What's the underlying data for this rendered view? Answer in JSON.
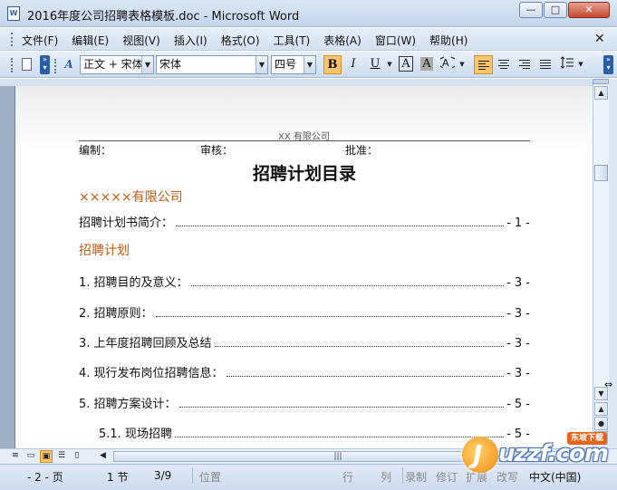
{
  "window": {
    "title": "2016年度公司招聘表格模板.doc - Microsoft Word",
    "icon": "word-doc-icon",
    "icon_text": "W",
    "min_glyph": "—",
    "max_glyph": "□",
    "close_glyph": "✕"
  },
  "menu": {
    "items": [
      "文件(F)",
      "编辑(E)",
      "视图(V)",
      "插入(I)",
      "格式(O)",
      "工具(T)",
      "表格(A)",
      "窗口(W)",
      "帮助(H)"
    ],
    "close_glyph": "✕"
  },
  "toolbar": {
    "style_value": "正文 + 宋体",
    "font_value": "宋体",
    "size_value": "四号",
    "bold_label": "B",
    "italic_label": "I",
    "underline_label": "U",
    "char_border_label": "A",
    "char_shading_label": "A",
    "styles_icon_label": "A",
    "active_color": "#f9c46c"
  },
  "document": {
    "header_company": "XX 有限公司",
    "header_fields": [
      "编制：",
      "审核：",
      "批准："
    ],
    "title": "招聘计划目录",
    "toc": [
      {
        "type": "h1",
        "text": "×××××有限公司"
      },
      {
        "type": "line",
        "text": "招聘计划书简介：",
        "page": "- 1 -"
      },
      {
        "type": "h1",
        "text": "招聘计划"
      },
      {
        "type": "line",
        "text": "1.  招聘目的及意义：",
        "page": "- 3 -"
      },
      {
        "type": "line",
        "text": "2.  招聘原则：",
        "page": "- 3 -"
      },
      {
        "type": "line",
        "text": "3.  上年度招聘回顾及总结",
        "page": "- 3 -"
      },
      {
        "type": "line",
        "text": "4.  现行发布岗位招聘信息：",
        "page": "- 3 -"
      },
      {
        "type": "line",
        "text": "5.  招聘方案设计：",
        "page": "- 5 -"
      },
      {
        "type": "sub",
        "text": "5.1.  现场招聘",
        "page": "- 5 -"
      }
    ],
    "heading_color": "#c55a11"
  },
  "statusbar": {
    "page": "- 2 - 页",
    "section": "1 节",
    "page_of": "3/9",
    "position": "位置",
    "line": "行",
    "column": "列",
    "record": "录制",
    "revise": "修订",
    "extend": "扩展",
    "overtype": "改写",
    "language": "中文(中国)"
  },
  "watermark": {
    "text": "uzzf.com",
    "badge": "东坡下载",
    "logo_letter": "J"
  },
  "hscroll_grip": "|||"
}
